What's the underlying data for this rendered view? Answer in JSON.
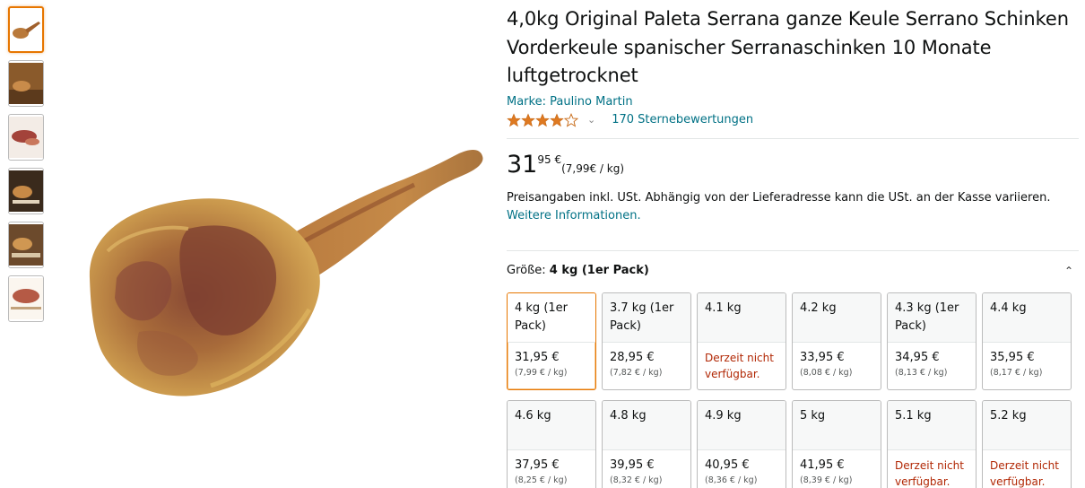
{
  "product": {
    "title": "4,0kg Original Paleta Serrana ganze Keule Serrano Schinken Vorderkeule spanischer Serranaschinken 10 Monate luftgetrocknet",
    "brand": "Marke: Paulino Martin",
    "rating_stars": 4,
    "rating_count": "170 Sternebewertungen",
    "price_whole": "31",
    "price_fraction": "95 €",
    "price_unit": "(7,99€ / kg)",
    "tax_text": "Preisangaben inkl. USt. Abhängig von der Lieferadresse kann die USt. an der Kasse variieren.",
    "tax_link": "Weitere Informationen.",
    "size_label": "Größe:",
    "size_selected": "4 kg (1er Pack)"
  },
  "icons": {
    "star_color": "#de7921",
    "accent": "#e77600",
    "link_color": "#007185"
  },
  "sizes": [
    {
      "name": "4 kg (1er Pack)",
      "price": "31,95 €",
      "unit": "(7,99 € / kg)",
      "available": true,
      "selected": true
    },
    {
      "name": "3.7 kg (1er Pack)",
      "price": "28,95 €",
      "unit": "(7,82 € / kg)",
      "available": true
    },
    {
      "name": "4.1 kg",
      "status": "Derzeit nicht verfügbar.",
      "available": false
    },
    {
      "name": "4.2 kg",
      "price": "33,95 €",
      "unit": "(8,08 € / kg)",
      "available": true
    },
    {
      "name": "4.3 kg (1er Pack)",
      "price": "34,95 €",
      "unit": "(8,13 € / kg)",
      "available": true
    },
    {
      "name": "4.4 kg",
      "price": "35,95 €",
      "unit": "(8,17 € / kg)",
      "available": true
    },
    {
      "name": "4.6 kg",
      "price": "37,95 €",
      "unit": "(8,25 € / kg)",
      "available": true
    },
    {
      "name": "4.8 kg",
      "price": "39,95 €",
      "unit": "(8,32 € / kg)",
      "available": true
    },
    {
      "name": "4.9 kg",
      "price": "40,95 €",
      "unit": "(8,36 € / kg)",
      "available": true
    },
    {
      "name": "5 kg",
      "price": "41,95 €",
      "unit": "(8,39 € / kg)",
      "available": true
    },
    {
      "name": "5.1 kg",
      "status": "Derzeit nicht verfügbar.",
      "available": false
    },
    {
      "name": "5.2 kg",
      "status": "Derzeit nicht verfügbar.",
      "available": false
    }
  ]
}
